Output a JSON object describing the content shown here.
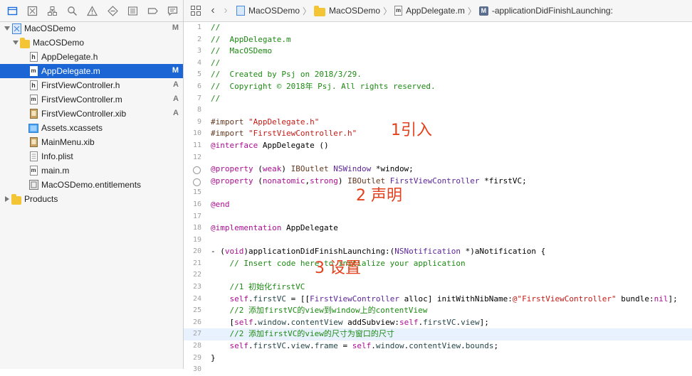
{
  "navigator": {
    "toolbar_icons": [
      "folder-icon",
      "source-control-icon",
      "hierarchy-icon",
      "search-icon",
      "warning-icon",
      "test-icon",
      "debug-icon",
      "breakpoint-icon",
      "report-icon"
    ],
    "items": [
      {
        "label": "MacOSDemo",
        "badge": "M",
        "kind": "project",
        "indent": 0,
        "disclosure": "open"
      },
      {
        "label": "MacOSDemo",
        "badge": "",
        "kind": "folder",
        "indent": 1,
        "disclosure": "open"
      },
      {
        "label": "AppDelegate.h",
        "badge": "",
        "kind": "h",
        "indent": 2,
        "disclosure": ""
      },
      {
        "label": "AppDelegate.m",
        "badge": "M",
        "kind": "m",
        "indent": 2,
        "disclosure": "",
        "selected": true
      },
      {
        "label": "FirstViewController.h",
        "badge": "A",
        "kind": "h",
        "indent": 2,
        "disclosure": ""
      },
      {
        "label": "FirstViewController.m",
        "badge": "A",
        "kind": "m",
        "indent": 2,
        "disclosure": ""
      },
      {
        "label": "FirstViewController.xib",
        "badge": "A",
        "kind": "xib",
        "indent": 2,
        "disclosure": ""
      },
      {
        "label": "Assets.xcassets",
        "badge": "",
        "kind": "assets",
        "indent": 2,
        "disclosure": ""
      },
      {
        "label": "MainMenu.xib",
        "badge": "",
        "kind": "xib",
        "indent": 2,
        "disclosure": ""
      },
      {
        "label": "Info.plist",
        "badge": "",
        "kind": "plist",
        "indent": 2,
        "disclosure": ""
      },
      {
        "label": "main.m",
        "badge": "",
        "kind": "m",
        "indent": 2,
        "disclosure": ""
      },
      {
        "label": "MacOSDemo.entitlements",
        "badge": "",
        "kind": "ent",
        "indent": 2,
        "disclosure": ""
      },
      {
        "label": "Products",
        "badge": "",
        "kind": "folder",
        "indent": 0,
        "disclosure": "closed"
      }
    ]
  },
  "jumpbar": {
    "crumbs": [
      "MacOSDemo",
      "MacOSDemo",
      "AppDelegate.m",
      "-applicationDidFinishLaunching:"
    ],
    "file_letter": "m",
    "method_letter": "M"
  },
  "editor": {
    "current_line": 27,
    "lines": [
      {
        "n": "1",
        "t": "//"
      },
      {
        "n": "2",
        "t": "//  AppDelegate.m"
      },
      {
        "n": "3",
        "t": "//  MacOSDemo"
      },
      {
        "n": "4",
        "t": "//"
      },
      {
        "n": "5",
        "t": "//  Created by Psj on 2018/3/29."
      },
      {
        "n": "6",
        "t": "//  Copyright © 2018年 Psj. All rights reserved."
      },
      {
        "n": "7",
        "t": "//"
      },
      {
        "n": "8",
        "t": ""
      },
      {
        "n": "9",
        "t": "#import \"AppDelegate.h\""
      },
      {
        "n": "10",
        "t": "#import \"FirstViewController.h\""
      },
      {
        "n": "11",
        "t": "@interface AppDelegate ()"
      },
      {
        "n": "12",
        "t": ""
      },
      {
        "n": "13",
        "t": "@property (weak) IBOutlet NSWindow *window;"
      },
      {
        "n": "14",
        "t": "@property (nonatomic,strong) IBOutlet FirstViewController *firstVC;"
      },
      {
        "n": "15",
        "t": ""
      },
      {
        "n": "16",
        "t": "@end"
      },
      {
        "n": "17",
        "t": ""
      },
      {
        "n": "18",
        "t": "@implementation AppDelegate"
      },
      {
        "n": "19",
        "t": ""
      },
      {
        "n": "20",
        "t": "- (void)applicationDidFinishLaunching:(NSNotification *)aNotification {"
      },
      {
        "n": "21",
        "t": "    // Insert code here to initialize your application"
      },
      {
        "n": "22",
        "t": ""
      },
      {
        "n": "23",
        "t": "    //1 初始化firstVC"
      },
      {
        "n": "24",
        "t": "    self.firstVC = [[FirstViewController alloc] initWithNibName:@\"FirstViewController\" bundle:nil];"
      },
      {
        "n": "25",
        "t": "    //2 添加firstVC的view到window上的contentView"
      },
      {
        "n": "26",
        "t": "    [self.window.contentView addSubview:self.firstVC.view];"
      },
      {
        "n": "27",
        "t": "    //2 添加firstVC的view的尺寸为窗口的尺寸"
      },
      {
        "n": "28",
        "t": "    self.firstVC.view.frame = self.window.contentView.bounds;"
      },
      {
        "n": "29",
        "t": "}"
      },
      {
        "n": "30",
        "t": ""
      }
    ],
    "annotations": [
      {
        "text": "1引入"
      },
      {
        "text": "2 声明"
      },
      {
        "text": "3 设置"
      }
    ]
  },
  "colors": {
    "selection": "#1b65d4",
    "annotation": "#e5401d",
    "comment": "#1c8a13",
    "keyword": "#aa0d91",
    "string": "#c41a16"
  }
}
